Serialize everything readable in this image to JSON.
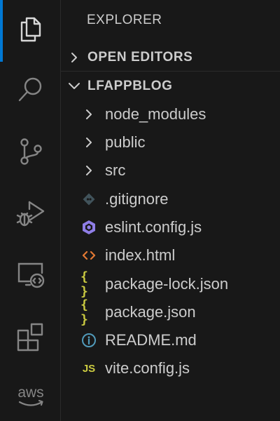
{
  "explorer": {
    "title": "EXPLORER",
    "open_editors_label": "OPEN EDITORS",
    "project_label": "LFAPPBLOG"
  },
  "activity_bar": [
    {
      "name": "explorer",
      "icon": "files-icon",
      "active": true
    },
    {
      "name": "search",
      "icon": "search-icon"
    },
    {
      "name": "source-control",
      "icon": "source-control-icon"
    },
    {
      "name": "run-and-debug",
      "icon": "run-debug-icon"
    },
    {
      "name": "remote-explorer",
      "icon": "remote-explorer-icon"
    },
    {
      "name": "extensions",
      "icon": "extensions-icon"
    },
    {
      "name": "aws",
      "icon": "aws-icon",
      "label": "aws"
    }
  ],
  "tree": {
    "folders": [
      {
        "name": "node_modules"
      },
      {
        "name": "public"
      },
      {
        "name": "src"
      }
    ],
    "files": [
      {
        "name": ".gitignore",
        "icon": "git-icon"
      },
      {
        "name": "eslint.config.js",
        "icon": "eslint-icon"
      },
      {
        "name": "index.html",
        "icon": "html-icon"
      },
      {
        "name": "package-lock.json",
        "icon": "json-icon",
        "glyph": "{ }"
      },
      {
        "name": "package.json",
        "icon": "json-icon",
        "glyph": "{ }"
      },
      {
        "name": "README.md",
        "icon": "info-icon"
      },
      {
        "name": "vite.config.js",
        "icon": "js-icon",
        "glyph": "JS"
      }
    ]
  },
  "colors": {
    "background": "#181818",
    "accent": "#0078d4",
    "text": "#cccccc",
    "icon_inactive": "#858585",
    "json_yellow": "#cbcb41",
    "html_orange": "#e37933",
    "eslint_purple": "#8f7ee7",
    "info_blue": "#519aba"
  }
}
